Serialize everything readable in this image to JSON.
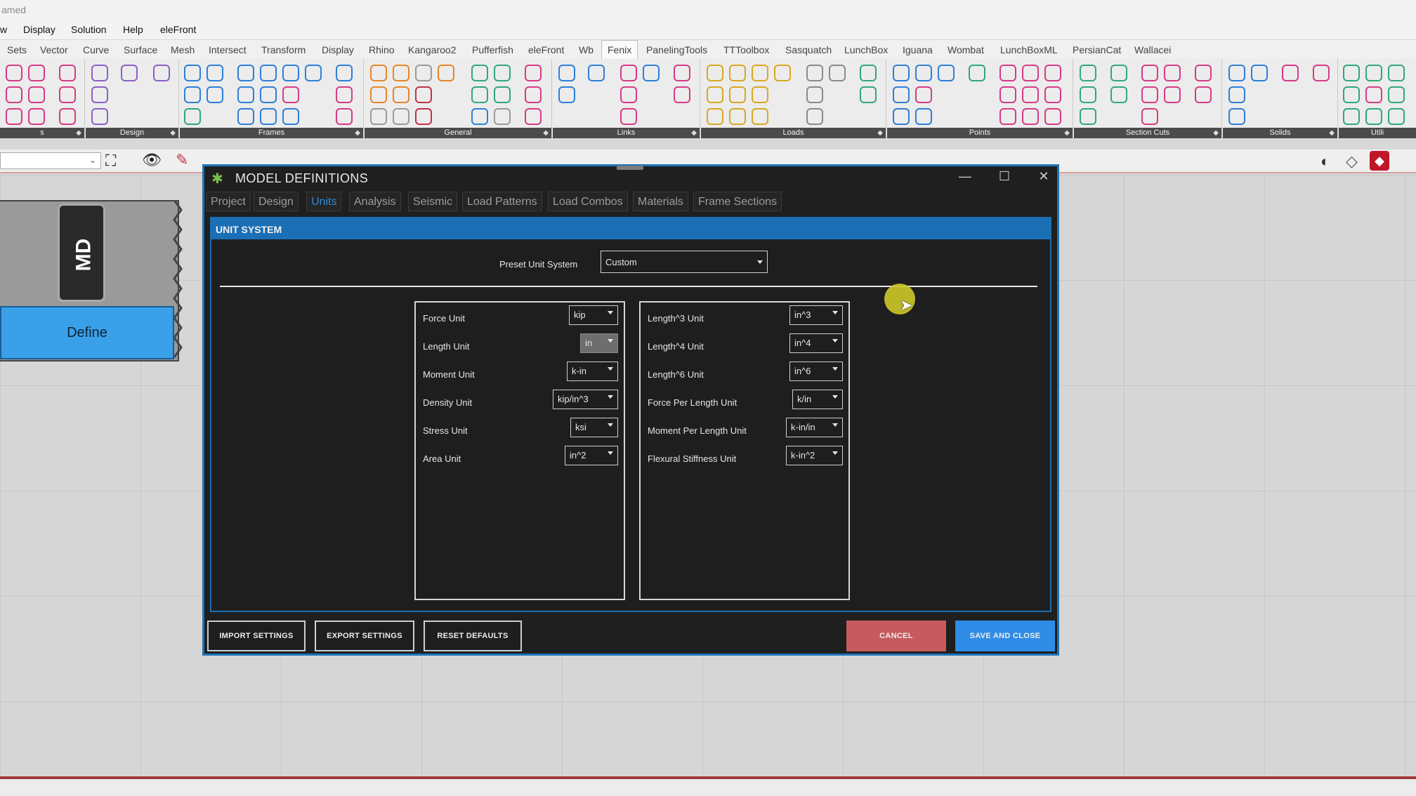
{
  "window": {
    "title_fragment": "amed"
  },
  "menu": [
    "w",
    "Display",
    "Solution",
    "Help",
    "eleFront"
  ],
  "ribbon_tabs": [
    "Sets",
    "Vector",
    "Curve",
    "Surface",
    "Mesh",
    "Intersect",
    "Transform",
    "Display",
    "Rhino",
    "Kangaroo2",
    "Pufferfish",
    "eleFront",
    "Wb",
    "Fenix",
    "PanelingTools",
    "TTToolbox",
    "Sasquatch",
    "LunchBox",
    "Iguana",
    "Wombat",
    "LunchBoxML",
    "PersianCat",
    "Wallacei"
  ],
  "active_ribbon_tab": "Fenix",
  "ribbon_groups": [
    "s",
    "Design",
    "Frames",
    "General",
    "Links",
    "Loads",
    "Points",
    "Section Cuts",
    "Solids",
    "Utili"
  ],
  "component": {
    "nickname": "MD",
    "button_label": "Define"
  },
  "dialog": {
    "title": "MODEL DEFINITIONS",
    "tabs": [
      "Project",
      "Design",
      "Units",
      "Analysis",
      "Seismic",
      "Load Patterns",
      "Load Combos",
      "Materials",
      "Frame Sections"
    ],
    "active_tab": "Units",
    "section_header": "UNIT SYSTEM",
    "preset_label": "Preset Unit System",
    "preset_value": "Custom",
    "left_units": [
      {
        "label": "Force Unit",
        "value": "kip"
      },
      {
        "label": "Length Unit",
        "value": "in"
      },
      {
        "label": "Moment Unit",
        "value": "k-in"
      },
      {
        "label": "Density Unit",
        "value": "kip/in^3"
      },
      {
        "label": "Stress Unit",
        "value": "ksi"
      },
      {
        "label": "Area Unit",
        "value": "in^2"
      }
    ],
    "right_units": [
      {
        "label": "Length^3 Unit",
        "value": "in^3"
      },
      {
        "label": "Length^4 Unit",
        "value": "in^4"
      },
      {
        "label": "Length^6 Unit",
        "value": "in^6"
      },
      {
        "label": "Force Per Length Unit",
        "value": "k/in"
      },
      {
        "label": "Moment Per Length Unit",
        "value": "k-in/in"
      },
      {
        "label": "Flexural Stiffness Unit",
        "value": "k-in^2"
      }
    ],
    "buttons": {
      "import": "IMPORT SETTINGS",
      "export": "EXPORT SETTINGS",
      "reset": "RESET DEFAULTS",
      "cancel": "CANCEL",
      "save": "SAVE AND CLOSE"
    }
  },
  "colors": {
    "accent": "#1a6fb5",
    "cancel": "#c65a5f",
    "save": "#2e8ce6",
    "active_tab": "#2f88d8"
  }
}
